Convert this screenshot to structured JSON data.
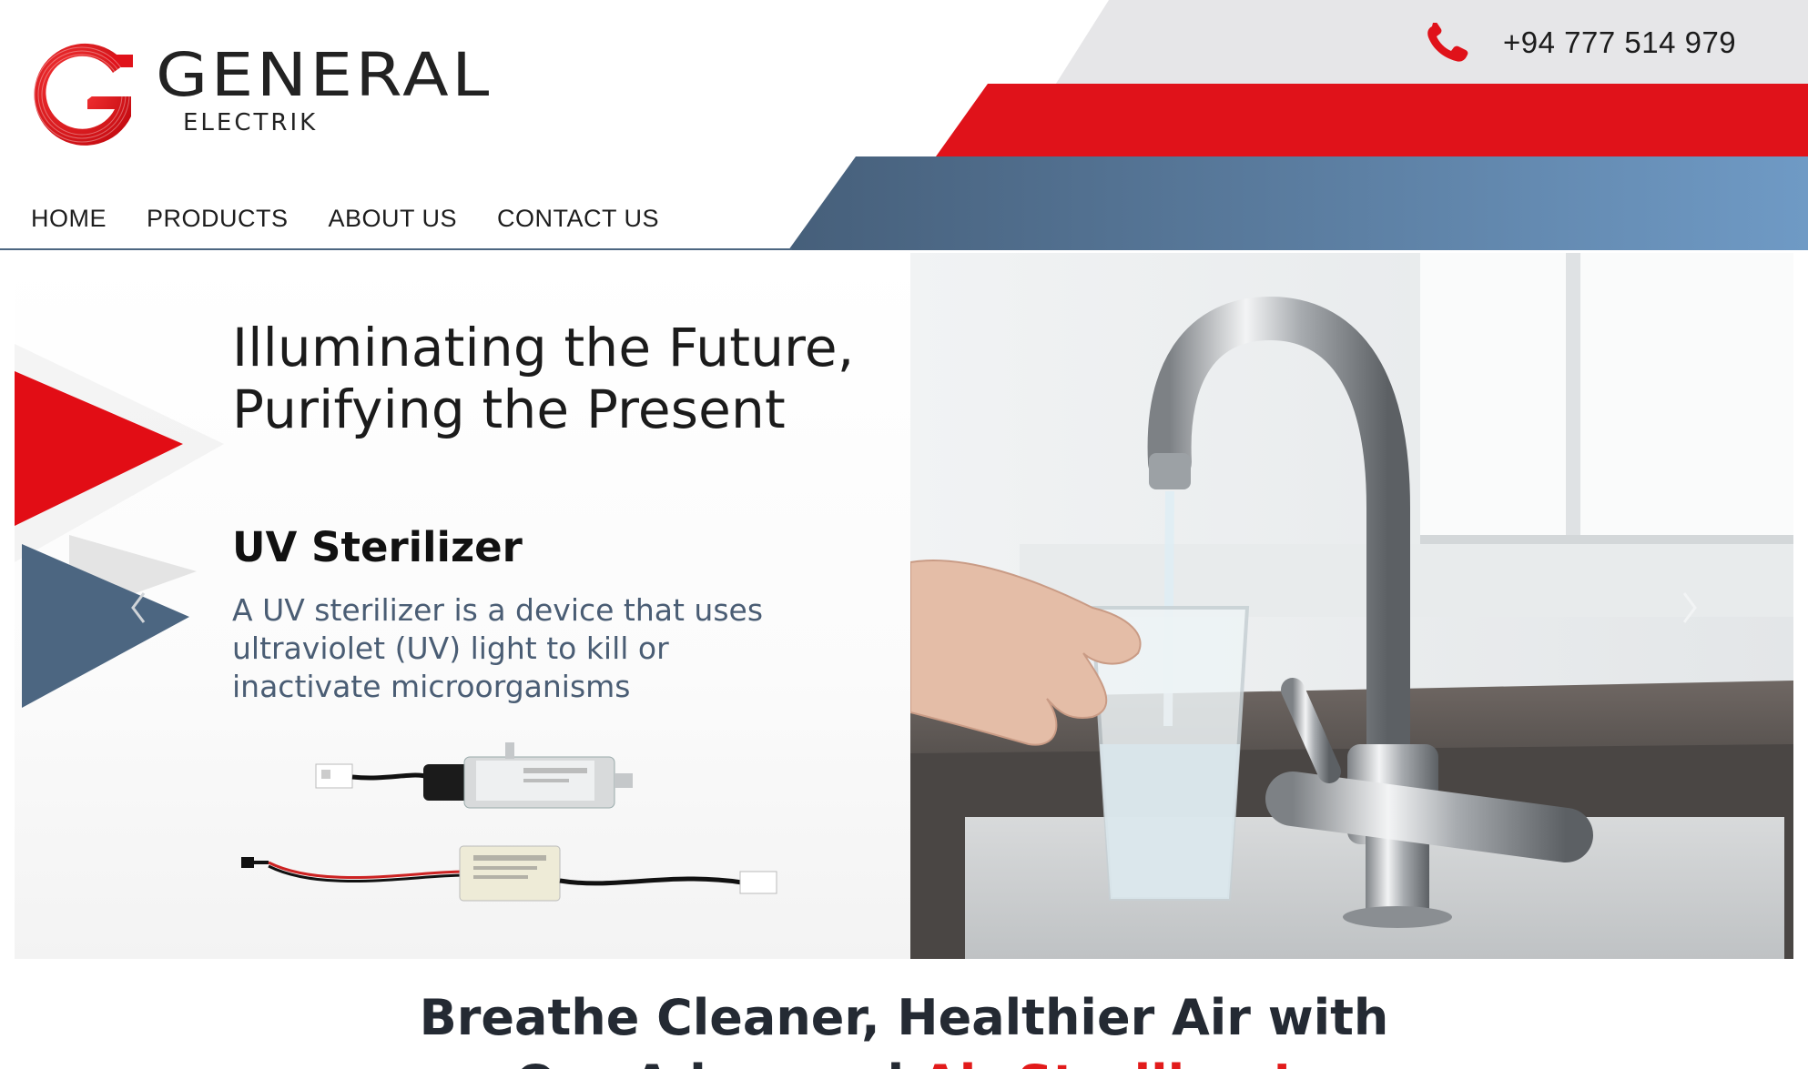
{
  "brand": {
    "name": "GENERAL",
    "tagline": "ELECTRIK",
    "logo_icon": "ge-logo-icon"
  },
  "header": {
    "phone_icon": "phone-icon",
    "phone_number": "+94 777 514 979"
  },
  "nav": {
    "items": [
      {
        "label": "HOME"
      },
      {
        "label": "PRODUCTS"
      },
      {
        "label": "ABOUT US"
      },
      {
        "label": "CONTACT US"
      }
    ]
  },
  "hero": {
    "heading_line1": "Illuminating the Future,",
    "heading_line2": "Purifying the Present",
    "subtitle": "UV Sterilizer",
    "description_lines": [
      "A UV sterilizer is a device that uses",
      "ultraviolet (UV) light to kill or",
      "inactivate microorganisms"
    ],
    "prev_icon": "chevron-left-icon",
    "next_icon": "chevron-right-icon"
  },
  "section": {
    "title_line1": "Breathe Cleaner, Healthier Air with",
    "title_line2_part1": "Our Advanced ",
    "title_line2_highlight": "Air Sterilizer!"
  },
  "colors": {
    "brand_red": "#e0121a",
    "brand_blue": "#4c6681",
    "light_grey": "#e6e6e8",
    "text_dark": "#1d1d1d",
    "desc_blue": "#4a5d74"
  }
}
